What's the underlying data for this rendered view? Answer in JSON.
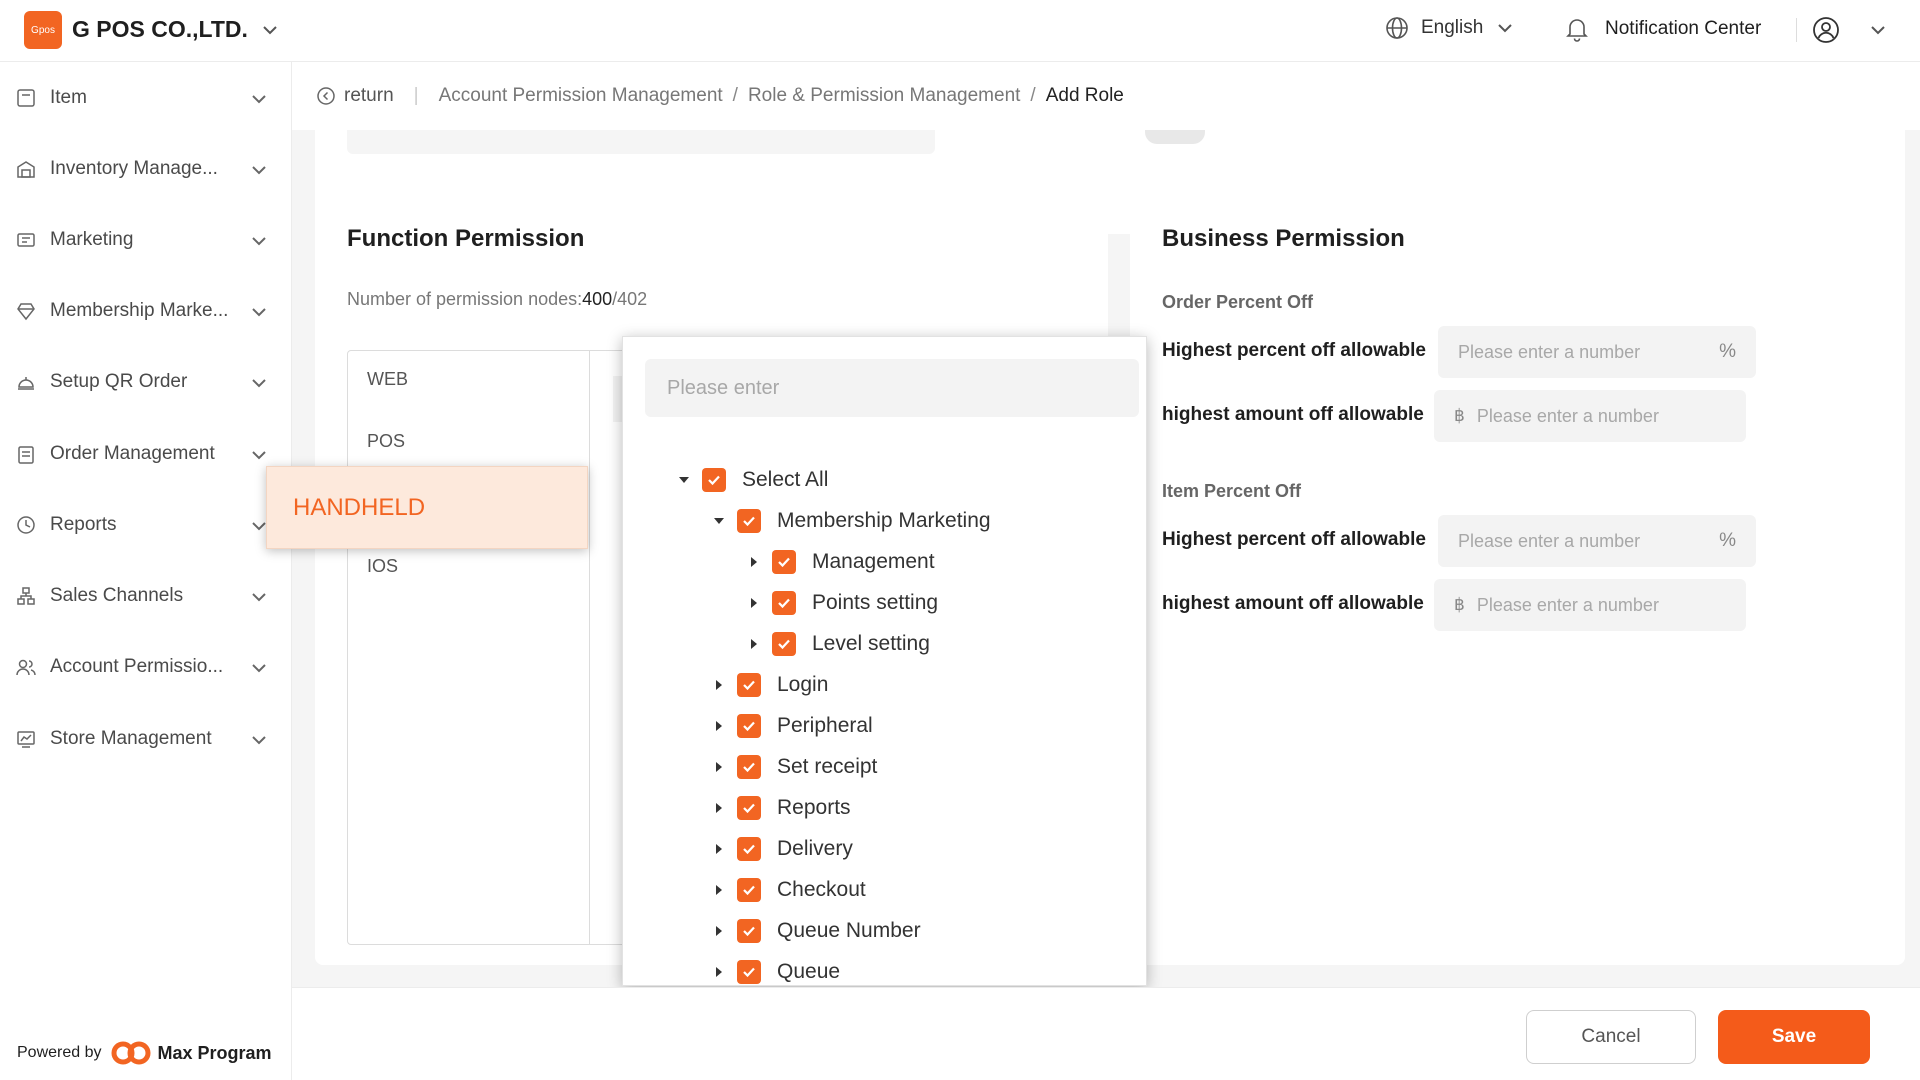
{
  "header": {
    "logo_text": "Gpos",
    "company": "G POS CO.,LTD.",
    "language": "English",
    "notification": "Notification Center"
  },
  "sidebar": {
    "items": [
      {
        "label": "Item",
        "icon": "item-icon"
      },
      {
        "label": "Inventory Manage...",
        "icon": "warehouse-icon"
      },
      {
        "label": "Marketing",
        "icon": "coupon-icon"
      },
      {
        "label": "Membership Marke...",
        "icon": "diamond-icon"
      },
      {
        "label": "Setup QR Order",
        "icon": "service-bell-icon"
      },
      {
        "label": "Order Management",
        "icon": "clipboard-icon"
      },
      {
        "label": "Reports",
        "icon": "clock-icon"
      },
      {
        "label": "Sales Channels",
        "icon": "channels-icon"
      },
      {
        "label": "Account Permissio...",
        "icon": "users-icon"
      },
      {
        "label": "Store Management",
        "icon": "chart-icon"
      }
    ],
    "powered_by": "Powered by",
    "brand": "Max Program"
  },
  "breadcrumb": {
    "return": "return",
    "items": [
      "Account Permission Management",
      "Role & Permission Management",
      "Add Role"
    ]
  },
  "top_card": {
    "input_placeholder": "Please enter"
  },
  "function_permission": {
    "title": "Function Permission",
    "nodes_label": "Number of permission nodes:",
    "nodes_selected": "400",
    "nodes_total": "/402",
    "tabs": [
      "WEB",
      "POS",
      "IOS"
    ],
    "dragging_tab": "HANDHELD"
  },
  "tree": {
    "search_placeholder": "Please enter",
    "rows": [
      {
        "label": "Select All",
        "level": 0,
        "expanded": true,
        "checked": true
      },
      {
        "label": "Membership Marketing",
        "level": 1,
        "expanded": true,
        "checked": true
      },
      {
        "label": "Management",
        "level": 2,
        "expanded": false,
        "checked": true
      },
      {
        "label": "Points setting",
        "level": 2,
        "expanded": false,
        "checked": true
      },
      {
        "label": "Level setting",
        "level": 2,
        "expanded": false,
        "checked": true
      },
      {
        "label": "Login",
        "level": 1,
        "expanded": false,
        "checked": true
      },
      {
        "label": "Peripheral",
        "level": 1,
        "expanded": false,
        "checked": true
      },
      {
        "label": "Set receipt",
        "level": 1,
        "expanded": false,
        "checked": true
      },
      {
        "label": "Reports",
        "level": 1,
        "expanded": false,
        "checked": true
      },
      {
        "label": "Delivery",
        "level": 1,
        "expanded": false,
        "checked": true
      },
      {
        "label": "Checkout",
        "level": 1,
        "expanded": false,
        "checked": true
      },
      {
        "label": "Queue Number",
        "level": 1,
        "expanded": false,
        "checked": true
      },
      {
        "label": "Queue",
        "level": 1,
        "expanded": false,
        "checked": true
      }
    ]
  },
  "business_permission": {
    "title": "Business Permission",
    "order_section": "Order Percent Off",
    "item_section": "Item Percent Off",
    "highest_percent_label": "Highest percent off allowable",
    "highest_amount_label": "highest amount off allowable",
    "number_placeholder": "Please enter a number",
    "percent_suffix": "%",
    "currency_prefix": "฿"
  },
  "footer": {
    "cancel": "Cancel",
    "save": "Save"
  },
  "colors": {
    "accent": "#f26522",
    "save_button": "#f45b1a",
    "dragging_bg": "#fde9dc"
  }
}
